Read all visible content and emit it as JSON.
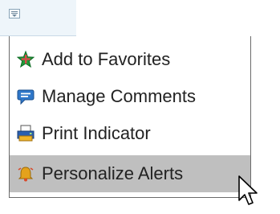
{
  "menu": {
    "items": [
      {
        "label": "Add to Favorites",
        "icon": "add-favorite-star-icon",
        "icon_color": "#1f9a3a"
      },
      {
        "label": "Manage Comments",
        "icon": "comment-bubble-icon",
        "icon_color": "#2f77c9"
      },
      {
        "label": "Print Indicator",
        "icon": "printer-icon",
        "icon_color": "#2a5fb0"
      },
      {
        "label": "Personalize Alerts",
        "icon": "alarm-bell-icon",
        "icon_color": "#e4a21c"
      }
    ],
    "highlighted_item": "Personalize Alerts"
  },
  "colors": {
    "highlight_bg": "#bfbfbf",
    "trigger_bg": "#eef5fa",
    "menu_border": "#6b6b6b"
  }
}
